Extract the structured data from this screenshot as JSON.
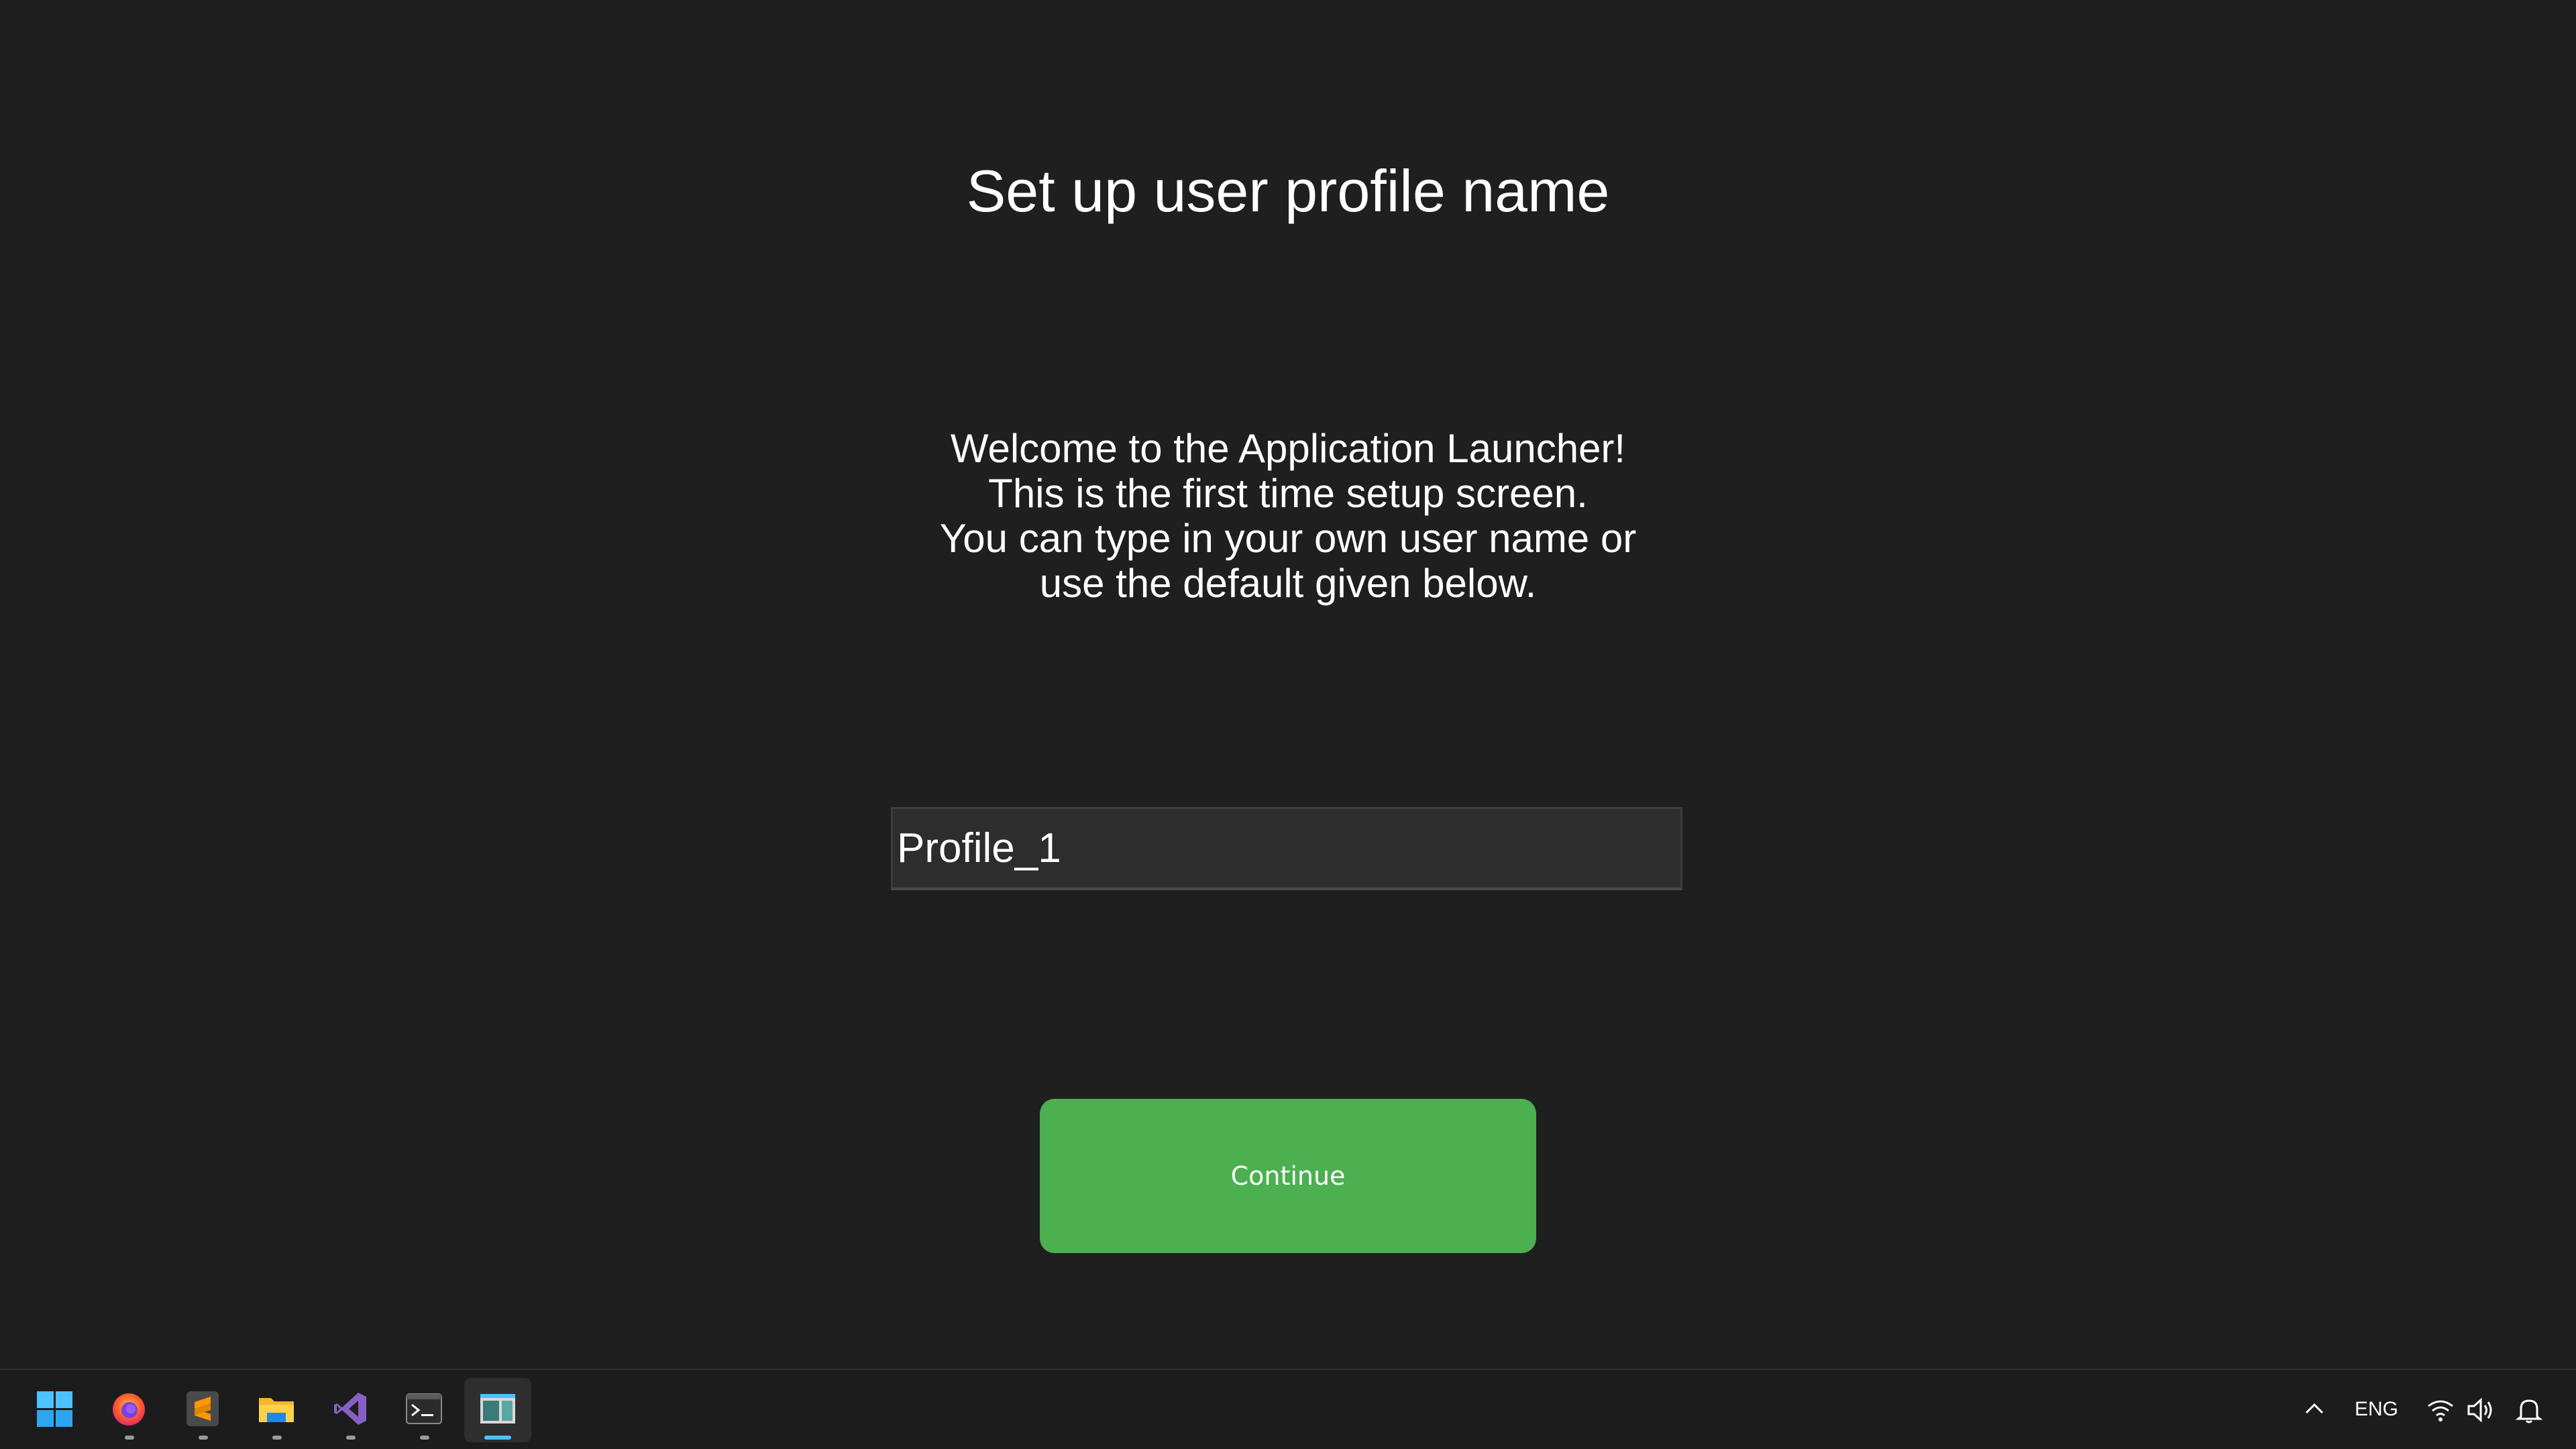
{
  "window": {
    "title": "Set up user profile name"
  },
  "welcome": {
    "line1": "Welcome to the Application Launcher!",
    "line2": "This is the first time setup screen.",
    "line3": "You can type in your own user name or",
    "line4": "use the default given below."
  },
  "profile_input": {
    "value": "Profile_1"
  },
  "continue_button": {
    "label": "Continue",
    "color": "#4caf50"
  },
  "taskbar": {
    "apps": [
      {
        "icon": "windows-start-icon"
      },
      {
        "icon": "firefox-icon"
      },
      {
        "icon": "sublime-text-icon"
      },
      {
        "icon": "file-explorer-icon"
      },
      {
        "icon": "visual-studio-icon"
      },
      {
        "icon": "terminal-icon"
      },
      {
        "icon": "app-launcher-icon",
        "active": true
      }
    ],
    "tray": {
      "language": "ENG",
      "icons": [
        "chevron-up-icon",
        "wifi-icon",
        "volume-icon",
        "notification-bell-icon"
      ]
    }
  },
  "colors": {
    "background": "#1f1f1f",
    "taskbar": "#1c1c1c",
    "input_background": "#2d2d2d",
    "accent": "#4cc2ff"
  }
}
